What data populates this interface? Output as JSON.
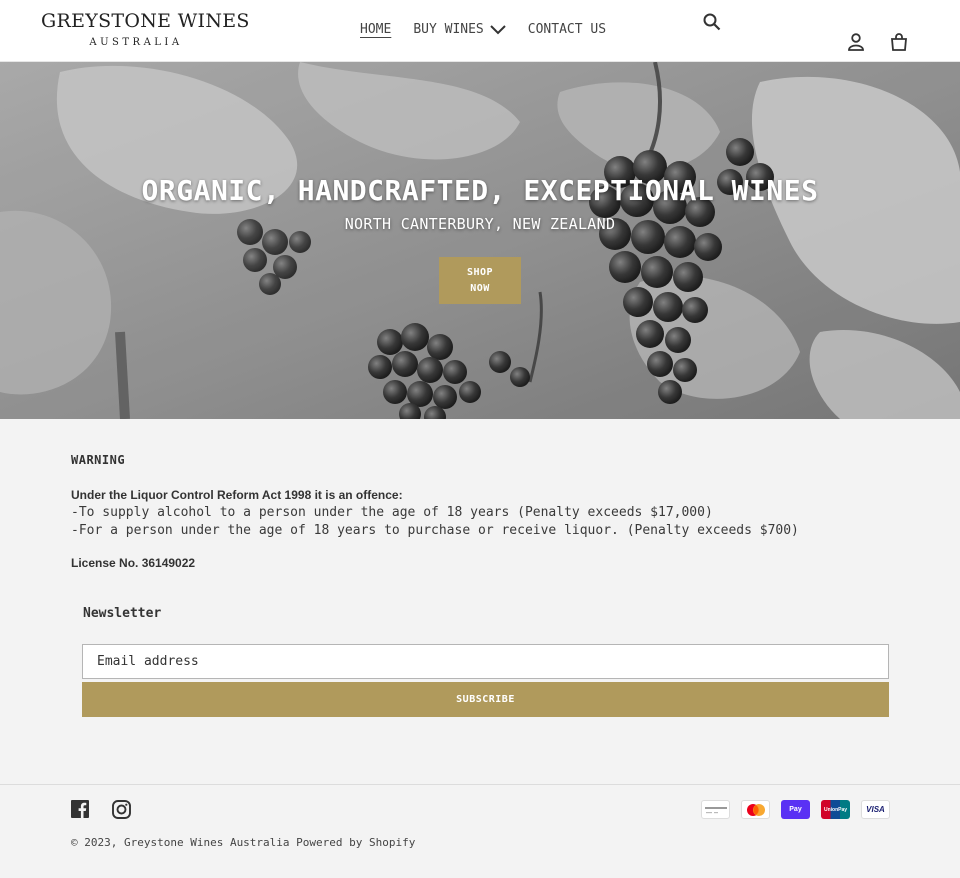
{
  "header": {
    "logo_main": "GREYSTONE WINES",
    "logo_sub": "AUSTRALIA",
    "nav": [
      {
        "label": "HOME"
      },
      {
        "label": "BUY WINES"
      },
      {
        "label": "CONTACT US"
      }
    ],
    "icons": {
      "search": "search-icon",
      "account": "account-icon",
      "cart": "cart-icon"
    }
  },
  "hero": {
    "title": "ORGANIC, HANDCRAFTED, EXCEPTIONAL WINES",
    "subtitle": "NORTH CANTERBURY, NEW ZEALAND",
    "button_line1": "SHOP",
    "button_line2": "NOW"
  },
  "warning": {
    "title": "WARNING",
    "heading": "Under the Liquor Control Reform Act 1998 it is an offence:",
    "lines": [
      "-To supply alcohol to a person under the age of 18 years (Penalty exceeds $17,000)",
      "-For a person under the age of 18 years to purchase or receive liquor. (Penalty exceeds $700)"
    ],
    "license": "License No. 36149022"
  },
  "newsletter": {
    "title": "Newsletter",
    "placeholder": "Email address",
    "button": "SUBSCRIBE"
  },
  "footer": {
    "social": [
      "facebook-icon",
      "instagram-icon"
    ],
    "copyright": "© 2023, Greystone Wines Australia",
    "powered": "Powered by Shopify",
    "payments": [
      {
        "name": "generic-card",
        "label": "",
        "color": "#ffffff"
      },
      {
        "name": "mastercard",
        "label": "",
        "color": "#ffffff"
      },
      {
        "name": "shop-pay",
        "label": "Pay",
        "color": "#5a31f4"
      },
      {
        "name": "unionpay",
        "label": "UnionPay",
        "color": "#d10429"
      },
      {
        "name": "visa",
        "label": "VISA",
        "color": "#ffffff"
      }
    ]
  },
  "colors": {
    "accent": "#b09a5c",
    "background": "#f3f3f3"
  }
}
